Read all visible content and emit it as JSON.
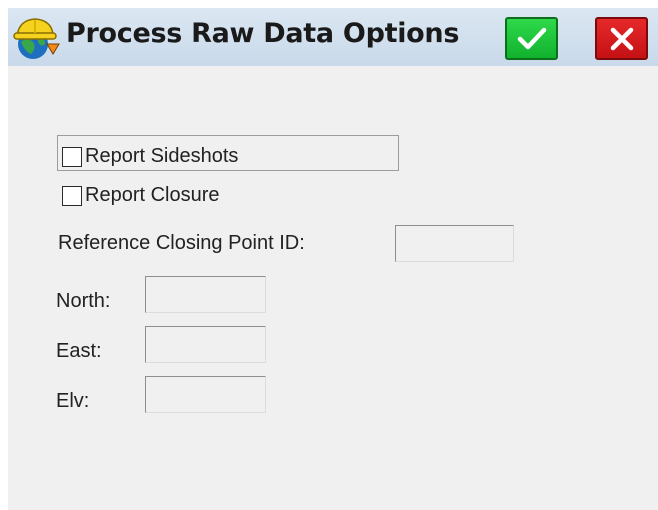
{
  "window": {
    "title": "Process Raw Data Options",
    "ok_icon": "checkmark-icon",
    "cancel_icon": "close-icon",
    "app_icon": "hardhat-globe-icon"
  },
  "options": {
    "report_sideshots": {
      "label": "Report Sideshots",
      "checked": false
    },
    "report_closure": {
      "label": "Report Closure",
      "checked": false
    }
  },
  "fields": {
    "closing_point": {
      "label": "Reference Closing Point ID:",
      "value": ""
    },
    "north": {
      "label": "North:",
      "value": ""
    },
    "east": {
      "label": "East:",
      "value": ""
    },
    "elv": {
      "label": "Elv:",
      "value": ""
    }
  },
  "colors": {
    "ok_green": "#18c236",
    "cancel_red": "#d81b1d",
    "titlebar": "#cfdeed",
    "background": "#f0f0f0"
  }
}
